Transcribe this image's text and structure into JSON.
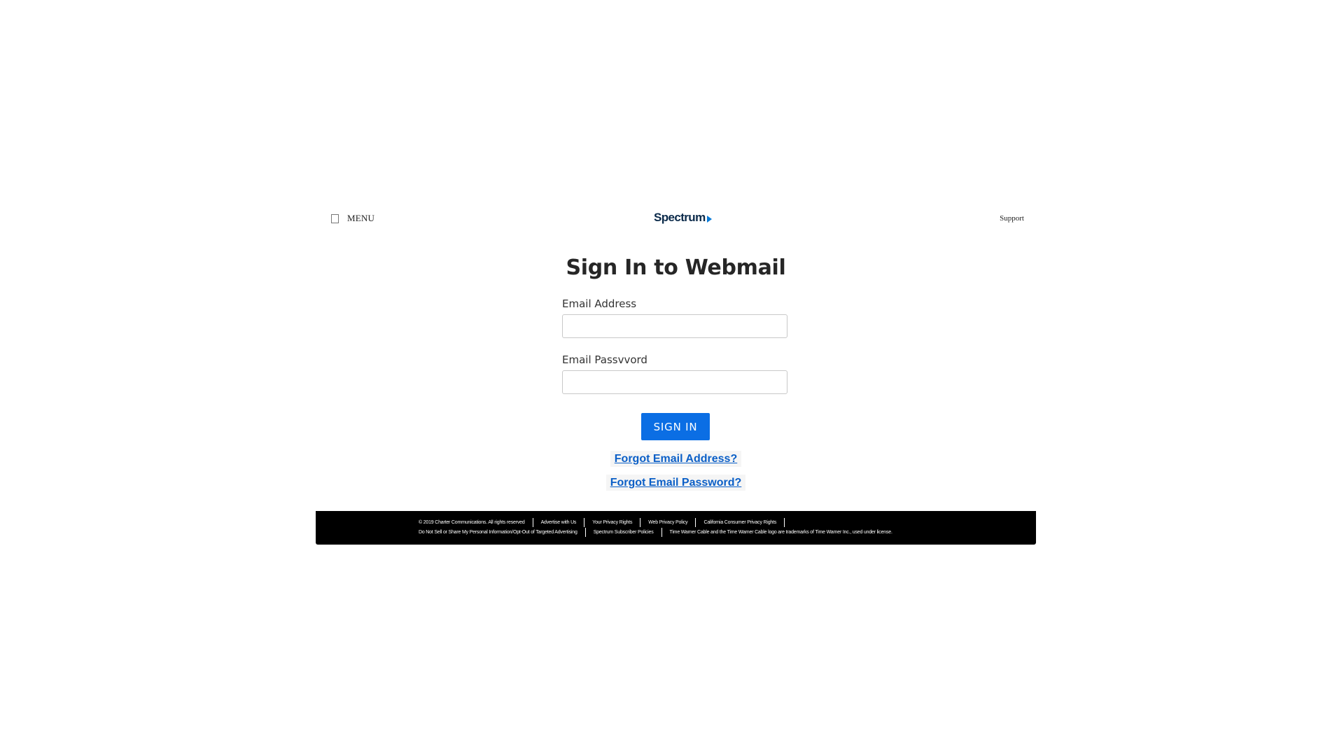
{
  "header": {
    "menu_label": "MENU",
    "logo_text": "Spectrum",
    "support_label": "Support"
  },
  "form": {
    "title": "Sign In to Webmail",
    "email_label": "Email Address",
    "email_value": "",
    "password_label": "Email Passvvord",
    "password_value": "",
    "signin_label": "SIGN IN",
    "forgot_email": "Forgot Email Address?",
    "forgot_password": "Forgot Email Password?"
  },
  "colors": {
    "button_blue": "#0b6ee4",
    "link_blue": "#0b5fc7",
    "logo_navy": "#0b2a4a",
    "logo_arrow": "#0a7bd8",
    "footer_bg": "#000000"
  },
  "footer": {
    "row1": [
      "© 2019 Charter Communications. All rights reserved",
      "Advertise with Us",
      "Your Privacy Rights",
      "Web Privacy Policy",
      "California Consumer Privacy Rights"
    ],
    "row2": [
      "Do Not Sell or Share My Personal Information/Opt-Out of Targeted Advertising",
      "Spectrum Subscriber Policies",
      "Time Warner Cable and the Time Warner Cable logo are trademarks of Time Warner Inc., used under license."
    ]
  }
}
